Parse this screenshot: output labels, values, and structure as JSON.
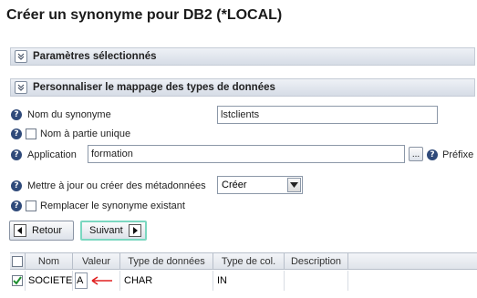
{
  "title": "Créer un synonyme pour DB2 (*LOCAL)",
  "sections": {
    "selected_params": "Paramètres sélectionnés",
    "custom_mapping": "Personnaliser le mappage des types de données"
  },
  "form": {
    "synonym_name_label": "Nom du synonyme",
    "synonym_name_value": "lstclients",
    "unique_part_label": "Nom à partie unique",
    "application_label": "Application",
    "application_value": "formation",
    "browse_label": "...",
    "prefix_label": "Préfixe",
    "metadata_label": "Mettre à jour ou créer des métadonnées",
    "metadata_value": "Créer",
    "replace_label": "Remplacer le synonyme existant"
  },
  "buttons": {
    "back": "Retour",
    "next": "Suivant"
  },
  "table": {
    "headers": [
      "Nom",
      "Valeur",
      "Type de données",
      "Type de col.",
      "Description"
    ],
    "rows": [
      {
        "checked": true,
        "name": "SOCIETE",
        "value": "A",
        "data_type": "CHAR",
        "col_type": "IN",
        "description": ""
      }
    ]
  },
  "colors": {
    "help": "#2f4a7a",
    "accent": "#7bd7c0",
    "annotation": "#e02020"
  },
  "icons": [
    "help-icon",
    "chevron-expand-icon",
    "checkbox-icon",
    "dropdown-arrow-icon",
    "back-arrow-icon",
    "next-arrow-icon",
    "red-arrow-annotation"
  ]
}
